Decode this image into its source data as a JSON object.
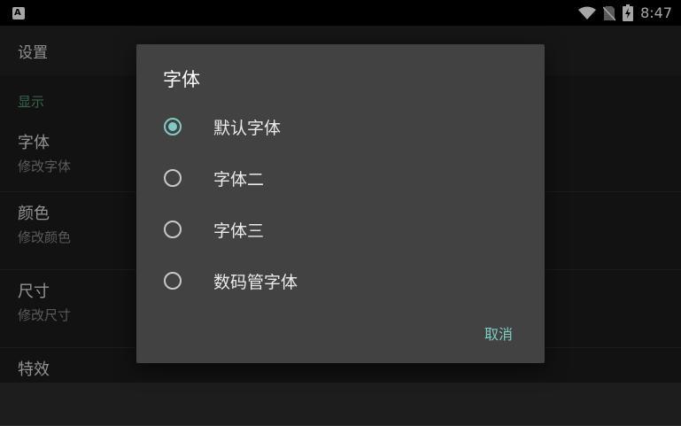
{
  "status": {
    "time": "8:47"
  },
  "app": {
    "title": "设置"
  },
  "settings": {
    "section": "显示",
    "items": [
      {
        "title": "字体",
        "summary": "修改字体"
      },
      {
        "title": "颜色",
        "summary": "修改颜色"
      },
      {
        "title": "尺寸",
        "summary": "修改尺寸"
      },
      {
        "title": "特效",
        "summary": ""
      }
    ]
  },
  "dialog": {
    "title": "字体",
    "options": [
      {
        "label": "默认字体",
        "selected": true
      },
      {
        "label": "字体二",
        "selected": false
      },
      {
        "label": "字体三",
        "selected": false
      },
      {
        "label": "数码管字体",
        "selected": false
      }
    ],
    "cancel_label": "取消"
  },
  "colors": {
    "accent": "#80cbc4",
    "dialog_bg": "#424242",
    "section_header": "#5a9a78"
  }
}
